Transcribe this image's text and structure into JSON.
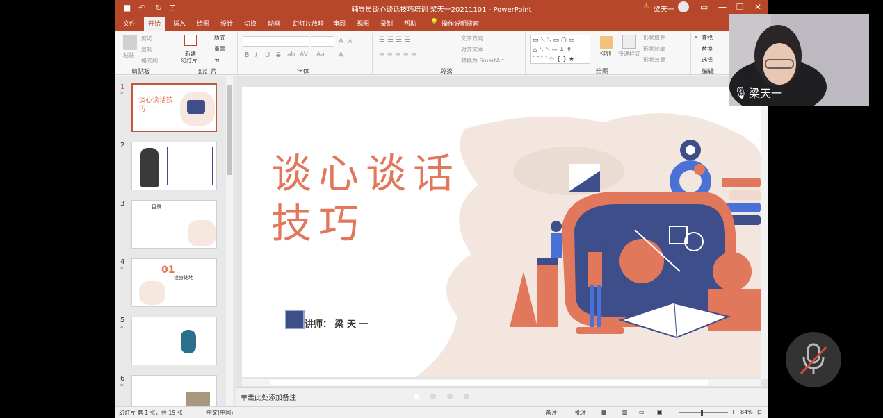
{
  "titlebar": {
    "title": "辅导员谈心谈话技巧培训  梁天一20211101  -  PowerPoint",
    "user": "梁天一",
    "warning": "⚠",
    "icons": [
      "save-icon",
      "undo-icon",
      "redo-icon",
      "present-icon"
    ]
  },
  "tabs": [
    "文件",
    "开始",
    "插入",
    "绘图",
    "设计",
    "切换",
    "动画",
    "幻灯片放映",
    "审阅",
    "视图",
    "录制",
    "帮助",
    "操作说明搜索"
  ],
  "ribbon": {
    "clipboard": {
      "paste": "粘贴",
      "cut": "剪切",
      "copy": "复制",
      "format": "格式刷",
      "label": "剪贴板"
    },
    "slides": {
      "new": "新建",
      "new2": "幻灯片",
      "layout": "版式",
      "reset": "重置",
      "section": "节",
      "label": "幻灯片"
    },
    "font": {
      "label": "字体",
      "bold": "B",
      "italic": "I",
      "underline": "U",
      "strike": "S",
      "shadow": "ab",
      "spacing": "AV",
      "case": "Aa",
      "grow": "A",
      "shrink": "A",
      "color": "A"
    },
    "paragraph": {
      "label": "段落",
      "dir": "文字方向",
      "align": "对齐文本",
      "smartart": "转换为 SmartArt"
    },
    "drawing": {
      "label": "绘图",
      "arrange": "排列",
      "quick": "快速样式",
      "fill": "形状填充",
      "outline": "形状轮廓",
      "effect": "形状效果"
    },
    "editing": {
      "label": "编辑",
      "find": "查找",
      "replace": "替换",
      "select": "选择"
    }
  },
  "thumbnails": [
    {
      "num": "1",
      "title": "谈心谈话技巧"
    },
    {
      "num": "2",
      "title": ""
    },
    {
      "num": "3",
      "title": "目录"
    },
    {
      "num": "4",
      "title": "01",
      "sub": "设身处地"
    },
    {
      "num": "5",
      "title": ""
    },
    {
      "num": "6",
      "title": ""
    }
  ],
  "slide": {
    "title_line1": "谈心谈话",
    "title_line2": "技巧",
    "lecturer": "讲师： 梁 天 一"
  },
  "notes": "单击此处添加备注",
  "status": {
    "slide_info": "幻灯片 第 1 张，共 19 张",
    "language": "中文(中国)",
    "notes_btn": "备注",
    "comments_btn": "批注",
    "zoom": "84%"
  },
  "webcam": {
    "name": "梁天一"
  },
  "colors": {
    "accent": "#b7472a",
    "title": "#e1775b",
    "navy": "#3d4e8a"
  }
}
